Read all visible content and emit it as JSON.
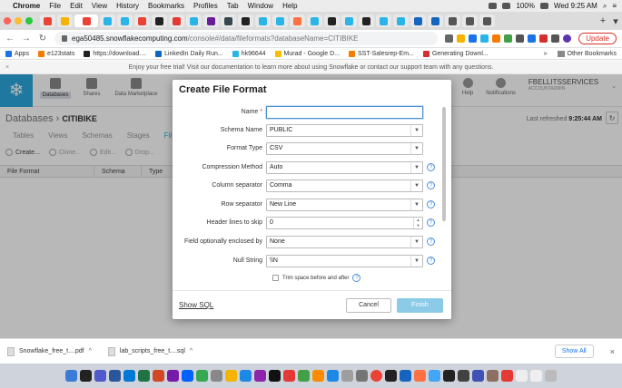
{
  "menubar": {
    "app": "Chrome",
    "items": [
      "File",
      "Edit",
      "View",
      "History",
      "Bookmarks",
      "Profiles",
      "Tab",
      "Window",
      "Help"
    ],
    "battery": "100%",
    "clock": "Wed 9:25 AM"
  },
  "browser": {
    "url_host": "ega50485.snowflakecomputing.com",
    "url_path": "/console#/data/fileformats?databaseName=CITIBIKE",
    "update_label": "Update",
    "bookmarks": [
      "Apps",
      "e123stats",
      "https://download....",
      "LinkedIn Daily Run...",
      "hk96644",
      "Murad - Google D...",
      "SST-Salesrep-Em...",
      "Generating Downl..."
    ],
    "bookmarks_more": "»",
    "other_bookmarks": "Other Bookmarks"
  },
  "trial_banner": "Enjoy your free trial! Visit our documentation to learn more about using Snowflake or contact our support team with any questions.",
  "sfheader": {
    "nav": [
      "Databases",
      "Shares",
      "Data Marketplace"
    ],
    "help_label": "Help",
    "notifications_label": "Notifications",
    "account_name": "FBELLITSSERVICES",
    "account_role": "ACCOUNTADMIN"
  },
  "page": {
    "crumb_root": "Databases",
    "crumb_sep": "›",
    "crumb_db": "CITIBIKE",
    "refreshed_label": "Last refreshed",
    "refreshed_time": "9:25:44 AM",
    "subtabs": [
      "Tables",
      "Views",
      "Schemas",
      "Stages",
      "Fil"
    ],
    "toolbar": [
      "Create...",
      "Clone...",
      "Edit...",
      "Drop..."
    ],
    "columns": [
      "File Format",
      "Schema",
      "Type"
    ]
  },
  "modal": {
    "title": "Create File Format",
    "fields": [
      {
        "label": "Name",
        "value": "",
        "required": true,
        "kind": "text"
      },
      {
        "label": "Schema Name",
        "value": "PUBLIC",
        "kind": "select"
      },
      {
        "label": "Format Type",
        "value": "CSV",
        "kind": "select"
      },
      {
        "label": "Compression Method",
        "value": "Auto",
        "kind": "select",
        "help": true
      },
      {
        "label": "Column separator",
        "value": "Comma",
        "kind": "select",
        "help": true
      },
      {
        "label": "Row separator",
        "value": "New Line",
        "kind": "select",
        "help": true
      },
      {
        "label": "Header lines to skip",
        "value": "0",
        "kind": "number",
        "help": true
      },
      {
        "label": "Field optionally enclosed by",
        "value": "None",
        "kind": "select",
        "help": true
      },
      {
        "label": "Null String",
        "value": "\\\\N",
        "kind": "select",
        "help": true
      }
    ],
    "trim_label": "Trim space before and after",
    "show_sql": "Show SQL",
    "cancel": "Cancel",
    "finish": "Finish"
  },
  "downloads": [
    {
      "name": "Snowflake_free_t....pdf"
    },
    {
      "name": "lab_scripts_free_t....sql"
    }
  ],
  "show_all": "Show All",
  "colors": {
    "snowflake_blue": "#29b5e8",
    "finish_disabled": "#8ccbe8",
    "focus_border": "#4a90d9"
  }
}
